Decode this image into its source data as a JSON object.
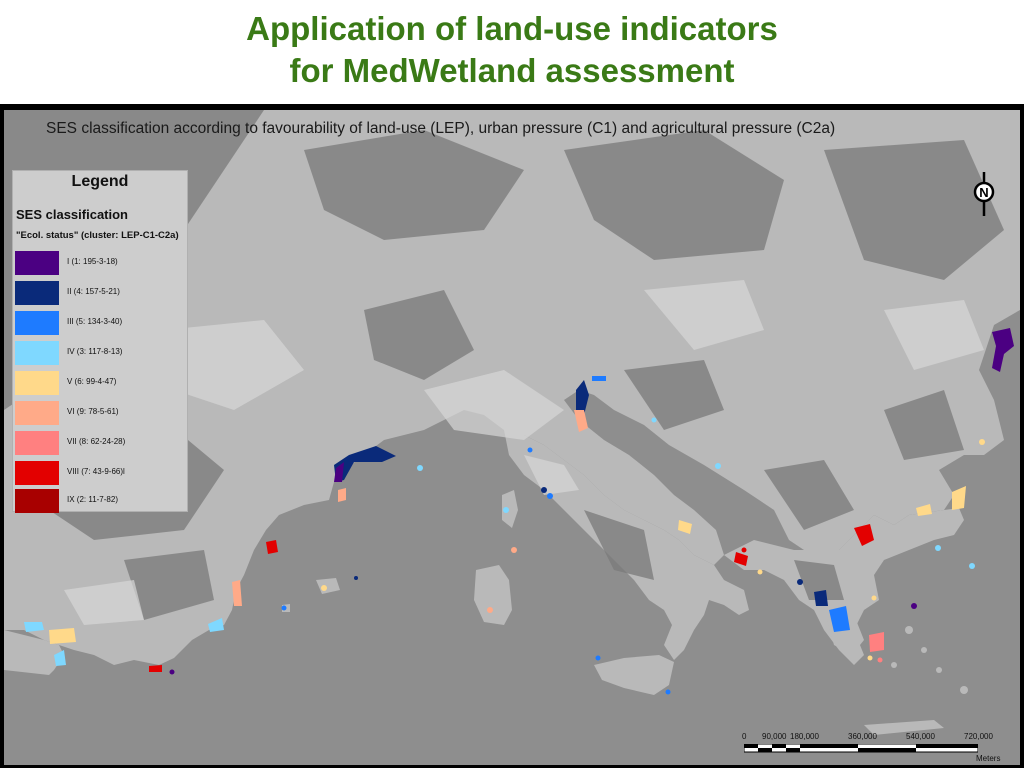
{
  "title": {
    "line1": "Application of land-use indicators",
    "line2": "for MedWetland assessment"
  },
  "map": {
    "subtitle": "SES classification according to favourability of land-use (LEP), urban pressure (C1) and agricultural pressure (C2a)",
    "sea_color": "#8e8e8e",
    "land_color": "#b9b9b9",
    "north_arrow_label": "N"
  },
  "legend": {
    "title": "Legend",
    "heading": "SES classification",
    "subheading": "\"Ecol. status\" (cluster: LEP-C1-C2a)",
    "items": [
      {
        "label": "I      (1: 195-3-18)",
        "color": "#4b0082"
      },
      {
        "label": "II     (4: 157-5-21)",
        "color": "#0a2a7a"
      },
      {
        "label": "III    (5: 134-3-40)",
        "color": "#1e7bff"
      },
      {
        "label": "IV    (3: 117-8-13)",
        "color": "#7fd8ff"
      },
      {
        "label": "V      (6: 99-4-47)",
        "color": "#ffd98a"
      },
      {
        "label": "VI     (9: 78-5-61)",
        "color": "#ffaa88"
      },
      {
        "label": "VII    (8: 62-24-28)",
        "color": "#ff8080"
      },
      {
        "label": "VIII (7: 43-9-66)l",
        "color": "#e30000"
      },
      {
        "label": "IX    (2: 11-7-82)",
        "color": "#a80000"
      }
    ]
  },
  "scale": {
    "ticks": [
      "0",
      "90,000",
      "180,000",
      "360,000",
      "540,000",
      "720,000"
    ],
    "unit": "Meters"
  }
}
